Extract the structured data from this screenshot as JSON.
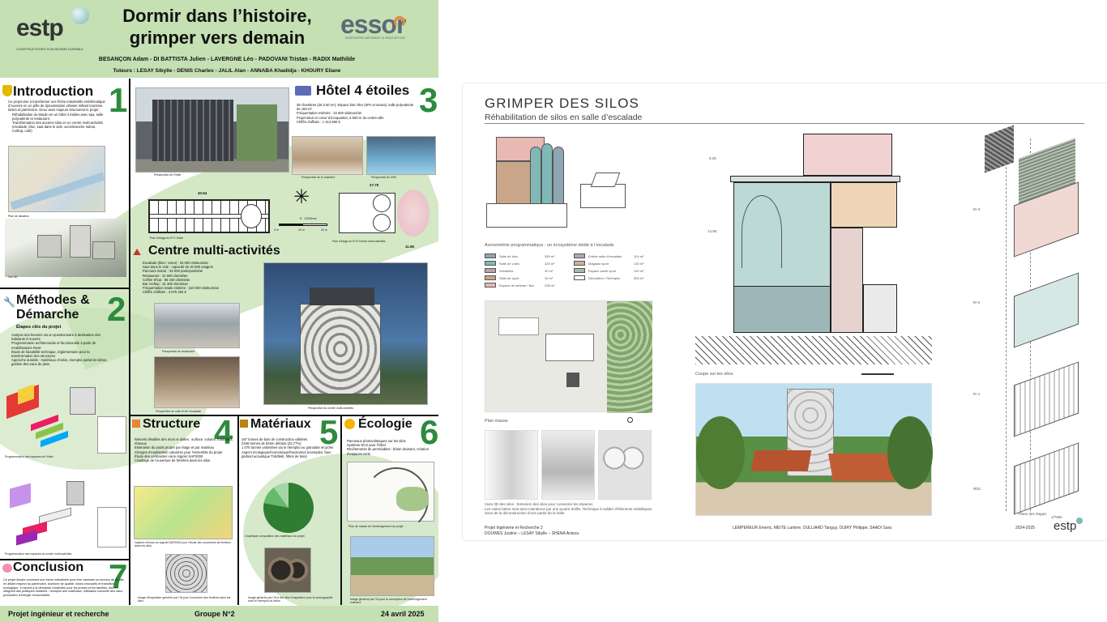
{
  "left_poster": {
    "title_line1": "Dormir dans l’histoire,",
    "title_line2": "grimper vers demain",
    "logo_left": "estp",
    "logo_left_sub": "CONSTRUCTEURS D’UN MONDE DURABLE",
    "logo_right": "essor",
    "logo_right_sub": "INGÉNIERIE BÂTIMENT & INNOVATION",
    "authors": "BESANÇON Adam - DI BATTISTA Julien - LAVERGNE Léo - PADOVANI Tristan - RADIX Mathilde",
    "tutors": "Tuteurs : LESAY Sibylle - DENIS Charles - JALIL Alan - ANNABA Khadidja - KHOURY Eliane",
    "sections": {
      "intro": {
        "title": "Introduction",
        "number": "1",
        "text": "Ce projet vise à transformer une friche industrielle emblématique d’Auxerre en un pôle de dynamisation urbaine mêlant tourisme, loisirs et patrimoine. Deux axes majeurs structurent le projet :",
        "bullets": [
          "Réhabilitation du Moulin en un hôtel 4 étoiles avec spa, salle polyvalente et restaurant",
          "Transformation des anciens silos en un centre multi-activités (escalade, bloc, saut dans le vide, accrobranche indoor, rooftop, café)"
        ],
        "cap1": "Plan de situation",
        "cap2": "Vue 3D"
      },
      "methodes": {
        "title_l1": "Méthodes &",
        "title_l2": "Démarche",
        "number": "2",
        "subtitle": "Étapes clés du projet",
        "items": [
          "Analyse des besoins via un questionnaire à destination des habitants d’Auxerre",
          "Programmation architecturale et fonctionnelle à partir de modélisations Revit",
          "Étude de faisabilité technique, réglementaire pour la transformation des structures",
          "Approche durable : matériaux choisis, réemploi partiel de béton, gestion des eaux de pluie"
        ],
        "cap1": "Programmation des espaces de l’hôtel",
        "cap2": "Programmation des espaces du centre multi-activités"
      },
      "hotel": {
        "title": "Hôtel 4 étoiles",
        "number": "3",
        "bullets": [
          "38 chambres (26 à 50 m²), Espace bien être (SPA et sauna), salle polyvalente de 150 m²",
          "Fréquentation estimée : 10 500 visiteurs/an",
          "Projet situé en cœur d’écoquartier, à 500 m du centre-ville",
          "Chiffre d’affaire : 1 413 660 €"
        ],
        "cap1": "Perspective de l’hôtel",
        "cap2": "Perspective de la chambre",
        "cap3": "Perspective du SPA",
        "cap4": "Plan d’étage du R+1 Hôtel",
        "cap5": "Plan d’étage du R+0 Centre multi-activités",
        "dim1": "40.64",
        "dim2": "27.75",
        "dim3": "11.96",
        "scale": "E : 1/200ème",
        "scale0": "0 m",
        "scale1": "10 m",
        "scale2": "20 m"
      },
      "centre": {
        "title": "Centre multi-activités",
        "bullets": [
          "Escalade (bloc+ voies) : 32 000 visiteurs/an",
          "Saut dans le vide : capacité de 20 000 usagers",
          "Parcours indoor : 32 000 participants/an",
          "Restaurant : 41 690 clients/an",
          "Coffee Shop : 56 340 clients/an",
          "Bar rooftop : 31 300 clients/an",
          "Fréquentation totale estimée : 210 030 visiteurs/an",
          "Chiffre d’affaire : 4 675 294 €"
        ],
        "cap1": "Perspective du restaurant",
        "cap2": "Perspective du café et de l’escalade",
        "cap3": "Perspective du centre multi-activités"
      },
      "structure": {
        "title": "Structure",
        "number": "4",
        "bullets": [
          "Relevés détaillés des murs et dalles : surface, volume, matériaux, réseaux",
          "Estimation du poids propre par étage et par matériau",
          "Charges d’exploitation calculées pour l’ensemble du projet",
          "Étude des contraintes via le logiciel SAP2000",
          "Cisaillage de l’ouverture de fenêtres dans les silos"
        ],
        "cap1": "Capture d’écran du logiciel SAP2000 pour l’étude des ouvertures de fenêtres dans les silos",
        "cap2": "Image d’inspiration générée par l’IA pour l’ouverture des fenêtres dans les silos"
      },
      "materiaux": {
        "title": "Matériaux",
        "number": "5",
        "bullets": [
          "167 tonnes de bois de construction utilisées",
          "2156 tonnes de béton détruits (22,77%)",
          "1 070 tonnes valorisées via le réemploi ou granulats recyclés",
          "Aspect écologique/économique/fonctionnel (exemples: faux plafond acoustique Troldtekt, filtres de bois)"
        ],
        "cap1": "Graphique composition des matériaux du projet",
        "cap2": "Image générée par l’IA à des fins d’inspiration pour la scénographie avec le réemploi du béton"
      },
      "ecologie": {
        "title": "Écologie",
        "number": "6",
        "bullets": [
          "Panneaux photovoltaïques sur les silos",
          "Système ECS pour l’hôtel",
          "Revêtements de perméables : béton drainant, création d’espaces verts"
        ],
        "cap1": "Plan de masse de l’aménagement du projet",
        "cap2": "Image générée par l’IA pour la conception de l’aménagement extérieur"
      },
      "conclusion": {
        "title": "Conclusion",
        "number": "7",
        "text": "Ce projet illustre comment une friche industrielle peut être valorisée au service de la ville, en alliant respect du patrimoine, tourisme de qualité, loisirs innovants et transition écologique. Il répond à la demande d’activités pour les jeunes et les familles, tout en intégrant des pratiques durables : réemploi des matériaux, infiltration naturelle des eaux, production d’énergie renouvelable."
      }
    },
    "footer_left": "Projet ingénieur et recherche",
    "footer_mid": "Groupe N°2",
    "footer_right": "24 avril 2025"
  },
  "right_poster": {
    "title": "GRIMPER DES SILOS",
    "subtitle": "Réhabilitation de silos en salle d’escalade",
    "axo_caption": "Axonométrie programmatique : un écosystème dédié à l’escalade",
    "legend": [
      {
        "label": "Salle de bloc",
        "area": "395 m²",
        "color": "#8fa6b3"
      },
      {
        "label": "Salle de voies",
        "area": "325 m²",
        "color": "#7fb8b5"
      },
      {
        "label": "Vestiaires",
        "area": "30 m²",
        "color": "#b9a3a8"
      },
      {
        "label": "Salle de sport",
        "area": "30 m²",
        "color": "#c9a58a"
      },
      {
        "label": "Espace de détente / Bar",
        "area": "238 m²",
        "color": "#e9b6b3"
      },
      {
        "label": "Entrée salle d’escalade",
        "area": "104 m²",
        "color": "#b5a5b7"
      },
      {
        "label": "Magasin sport",
        "area": "130 m²",
        "color": "#c9b39a"
      },
      {
        "label": "Espace santé sport",
        "area": "132 m²",
        "color": "#a9b9a8"
      },
      {
        "label": "Démolition / Réemploi",
        "area": "595 m²",
        "color": "#ffffff"
      }
    ],
    "plan_caption": "Plan masse",
    "vues_caption": "Vues 3D des silos : Extrusion des silos pour connecter les espaces",
    "vues_text": "Les voiles béton sont ainsi maintenus par une poutre treillis. Technique à valider d’éléments métalliques issus de la déconstruction d’une partie de la halle",
    "section_caption": "Coupe sur les silos",
    "dim_top": "8.30",
    "dim_mid": "14.90",
    "levels": [
      "R+3",
      "R+2",
      "R+1",
      "RDC"
    ],
    "plans_caption": "Plans des étages",
    "plans_scale": "1/750e",
    "authors": "LEMPEREUR Emeric, MEITE Lamine, OULLIARD Tanguy, OUIRY Philippe, SAADI Sara",
    "course_l1": "Projet Ingénierie et Recherche 2",
    "course_l2": "DOUWES Justine – LESAY Sibylle – SHENA Anieza",
    "year": "2024-2025",
    "logo": "estp"
  }
}
